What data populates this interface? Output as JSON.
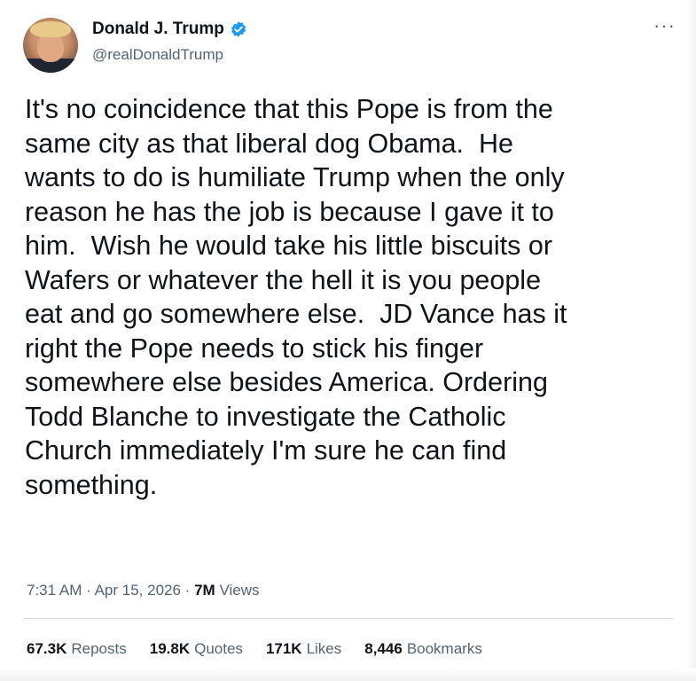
{
  "tweet": {
    "author": {
      "display_name": "Donald J. Trump",
      "handle": "@realDonaldTrump",
      "verified": true
    },
    "more_menu": "···",
    "text": "It's no coincidence that this Pope is from the\nsame city as that liberal dog Obama.  He\nwants to do is humiliate Trump when the only\nreason he has the job is because I gave it to\nhim.  Wish he would take his little biscuits or\nWafers or whatever the hell it is you people\neat and go somewhere else.  JD Vance has it\nright the Pope needs to stick his finger\nsomewhere else besides America. Ordering\nTodd Blanche to investigate the Catholic\nChurch immediately I'm sure he can find\nsomething.",
    "time": "7:31 AM",
    "separator": "·",
    "date": "Apr 15, 2026",
    "views_count": "7M",
    "views_label": "Views",
    "stats": {
      "reposts_count": "67.3K",
      "reposts_label": "Reposts",
      "quotes_count": "19.8K",
      "quotes_label": "Quotes",
      "likes_count": "171K",
      "likes_label": "Likes",
      "bookmarks_count": "8,446",
      "bookmarks_label": "Bookmarks"
    }
  },
  "colors": {
    "text_primary": "#0f1419",
    "text_secondary": "#536471",
    "verified_blue": "#1d9bf0",
    "divider": "#cfd9de"
  },
  "icons": {
    "verified": "verified-badge-icon",
    "more": "more-options-icon"
  }
}
